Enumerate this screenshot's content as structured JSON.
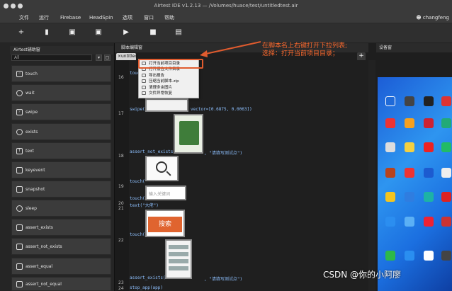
{
  "window": {
    "title": "Airtest IDE v1.2.13 — /Volumes/huace/test/untitledtest.air",
    "user": "changfeng",
    "menu": [
      "文件",
      "运行",
      "Firebase",
      "HeadSpin",
      "选项",
      "窗口",
      "帮助"
    ]
  },
  "toolbar": {
    "icons": [
      "new-icon",
      "open-folder-icon",
      "save-icon",
      "save-all-icon",
      "run-icon",
      "stop-icon",
      "report-icon"
    ]
  },
  "assist_panel": {
    "title": "Airtest辅助窗",
    "search_placeholder": "All",
    "apis": [
      "touch",
      "wait",
      "swipe",
      "exists",
      "text",
      "keyevent",
      "snapshot",
      "sleep",
      "assert_exists",
      "assert_not_exists",
      "assert_equal",
      "assert_not_equal"
    ]
  },
  "editor": {
    "title": "脚本编辑窗",
    "tab_label": "untitled",
    "lines": [
      {
        "num": "16",
        "code": "touch("
      },
      {
        "num": "17",
        "code": "swipe(",
        "after": "vector=[0.6875, 0.0063])"
      },
      {
        "num": "18",
        "code": "assert_not_exists(",
        "after": ", \"请填写测试点\")"
      },
      {
        "num": "19",
        "code": "touch("
      },
      {
        "num": "20",
        "code": "touch("
      },
      {
        "num": "21",
        "code": "text(\"大佬\")"
      },
      {
        "num": "22",
        "code": "touch("
      },
      {
        "num": "23",
        "code": "assert_exists(",
        "after": ", \"请填写测试点\")"
      },
      {
        "num": "24",
        "code": "stop_app(app)"
      }
    ],
    "thumbnails": {
      "input_placeholder": "输入关键词",
      "search_button": "搜索"
    }
  },
  "context_menu": {
    "items": [
      "打开当前项目目录",
      "打开报告文件目录",
      "导出报告",
      "压缩当前脚本.zip",
      "清理多余图片",
      "文件异常恢复"
    ]
  },
  "annotation": {
    "line1": "在脚本名上右键打开下拉列表;",
    "line2": "选择：打开当前项目目录；"
  },
  "device_panel": {
    "title": "设备窗"
  },
  "watermark": "CSDN @你的小阿廖",
  "colors": {
    "accent": "#e05b2e",
    "annotation": "#ff6a2d",
    "code": "#8ec0ff"
  }
}
